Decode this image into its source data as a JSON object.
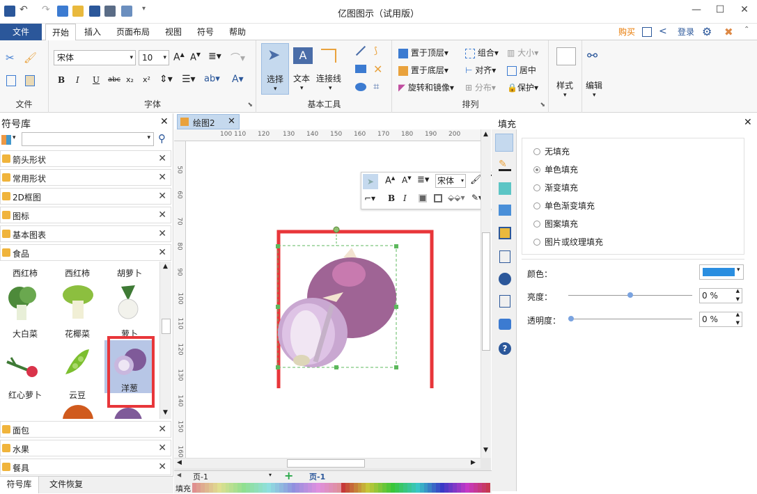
{
  "window": {
    "title": "亿图图示（试用版）",
    "minimize": "—",
    "maximize": "☐",
    "close": "✕"
  },
  "menu": {
    "tabs": [
      "文件",
      "开始",
      "插入",
      "页面布局",
      "视图",
      "符号",
      "帮助"
    ],
    "right": {
      "buy": "购买",
      "login": "登录"
    }
  },
  "ribbon": {
    "file_group": {
      "label": "文件"
    },
    "font_group": {
      "font_name": "宋体",
      "font_size": "10",
      "label": "字体"
    },
    "tools_group": {
      "select": "选择",
      "text": "文本",
      "connector": "连接线",
      "label": "基本工具"
    },
    "arrange_group": {
      "bring_front": "置于顶层",
      "send_back": "置于底层",
      "rotate_mirror": "旋转和镜像",
      "group": "组合",
      "align": "对齐",
      "distribute": "分布",
      "size": "大小",
      "center": "居中",
      "protect": "保护",
      "label": "排列"
    },
    "style": "样式",
    "edit": "编辑"
  },
  "library": {
    "title": "符号库",
    "categories_top": [
      "箭头形状",
      "常用形状",
      "2D框图",
      "图标",
      "基本图表",
      "食品"
    ],
    "shape_row1_labels": [
      "西红柿",
      "西红柿",
      "胡萝卜"
    ],
    "shape_row2_labels": [
      "大白菜",
      "花椰菜",
      "萝卜"
    ],
    "shape_row3_labels": [
      "红心萝卜",
      "云豆",
      "洋葱"
    ],
    "categories_bottom": [
      "面包",
      "水果",
      "餐具"
    ],
    "bottom_tabs": [
      "符号库",
      "文件恢复"
    ]
  },
  "canvas": {
    "doc_tab": "绘图2",
    "ruler_h": [
      "100",
      "110",
      "120",
      "130",
      "140",
      "150",
      "160",
      "170",
      "180",
      "190",
      "200"
    ],
    "ruler_v": [
      "50",
      "60",
      "70",
      "80",
      "90",
      "100",
      "110",
      "120",
      "130",
      "140",
      "150",
      "160"
    ],
    "mini_toolbar_font": "宋体",
    "page_nav": "页-1",
    "page_tab": "页-1",
    "fill_label": "填充"
  },
  "fill_panel": {
    "title": "填充",
    "options": [
      "无填充",
      "单色填充",
      "渐变填充",
      "单色渐变填充",
      "图案填充",
      "图片或纹理填充"
    ],
    "selected_index": 1,
    "color_label": "颜色：",
    "color_value": "#2a8ee0",
    "brightness_label": "亮度：",
    "brightness_value": "0 %",
    "brightness_level": 0.5,
    "transparency_label": "透明度：",
    "transparency_value": "0 %",
    "transparency_level": 0.0
  },
  "colors": {
    "accent": "#2b579a",
    "highlight": "#e8363a",
    "selection": "#5cb85c",
    "orange": "#e87800"
  }
}
